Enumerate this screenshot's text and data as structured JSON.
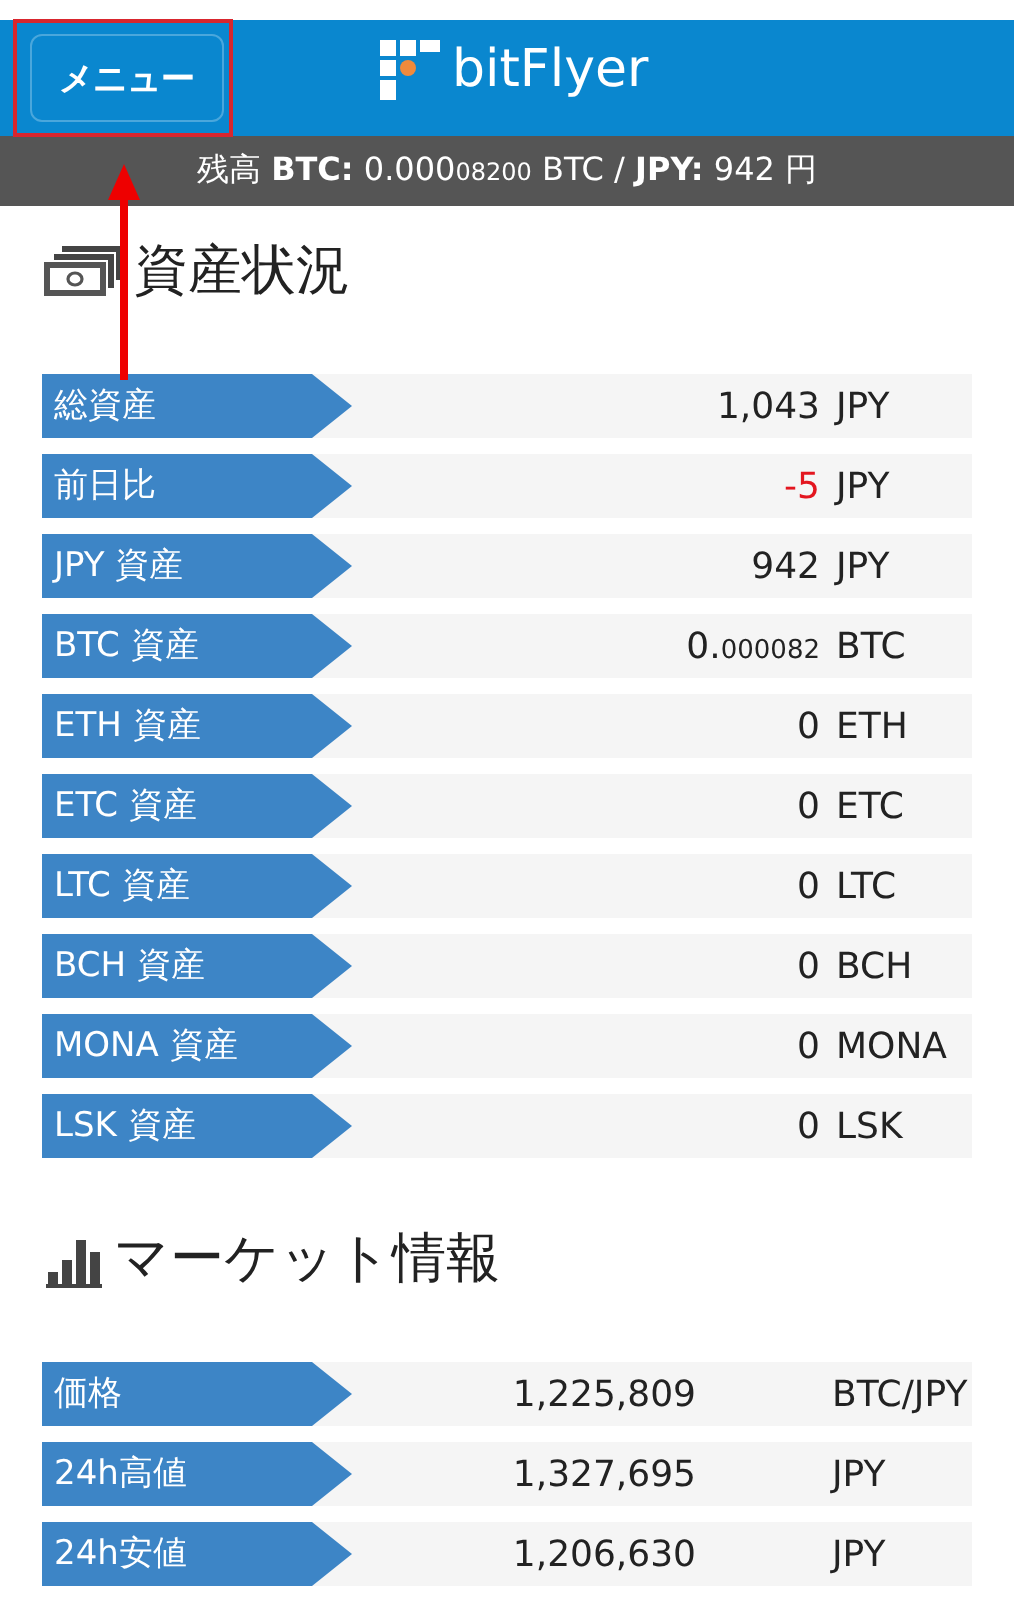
{
  "header": {
    "menu_button": "メニュー",
    "logo": "bitFlyer"
  },
  "balance": {
    "before": "残高 **BTC:** 0.000",
    "small": "08200",
    "after": " BTC / **JPY:** 942 円"
  },
  "sections": [
    {
      "title": "資産状況",
      "kind": "assets",
      "rows": [
        {
          "label": "総資産",
          "value": "1,043",
          "unit": "JPY",
          "negative": false
        },
        {
          "label": "前日比",
          "value": "-5",
          "unit": "JPY",
          "negative": true
        },
        {
          "label": "JPY 資産",
          "value": "942",
          "unit": "JPY",
          "negative": false
        },
        {
          "label": "BTC 資産",
          "value": "0.",
          "value_small": "000082",
          "unit": "BTC",
          "negative": false
        },
        {
          "label": "ETH 資産",
          "value": "0",
          "unit": "ETH",
          "negative": false
        },
        {
          "label": "ETC 資産",
          "value": "0",
          "unit": "ETC",
          "negative": false
        },
        {
          "label": "LTC 資産",
          "value": "0",
          "unit": "LTC",
          "negative": false
        },
        {
          "label": "BCH 資産",
          "value": "0",
          "unit": "BCH",
          "negative": false
        },
        {
          "label": "MONA 資産",
          "value": "0",
          "unit": "MONA",
          "negative": false
        },
        {
          "label": "LSK 資産",
          "value": "0",
          "unit": "LSK",
          "negative": false
        }
      ]
    },
    {
      "title": "マーケット情報",
      "kind": "market",
      "rows": [
        {
          "label": "価格",
          "value": "1,225,809",
          "unit": "BTC/JPY"
        },
        {
          "label": "24h高値",
          "value": "1,327,695",
          "unit": "JPY"
        },
        {
          "label": "24h安値",
          "value": "1,206,630",
          "unit": "JPY"
        }
      ]
    }
  ]
}
